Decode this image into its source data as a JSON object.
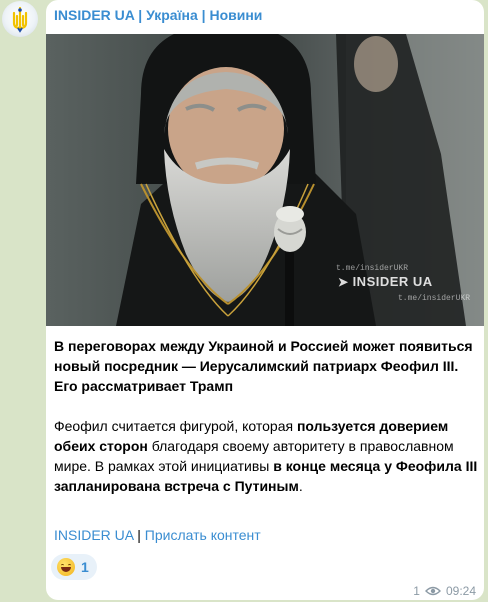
{
  "channel": {
    "name": "INSIDER UA | Україна | Новини",
    "avatar_icon": "trident-icon"
  },
  "photo": {
    "watermark_top": "t.me/insiderUKR",
    "watermark_brand": "INSIDER UA",
    "watermark_bottom": "t.me/insiderUKR",
    "plane_icon": "telegram-plane-icon"
  },
  "message": {
    "headline": "В переговорах между Украиной и Россией может появиться новый посредник — Иерусалимский патриарх Феофил III. Его рассматривает Трамп",
    "p2_a": "Феофил считается фигурой, которая ",
    "p2_b": "пользуется доверием обеих сторон",
    "p2_c": " благодаря своему авторитету в православном мире. В рамках этой инициативы ",
    "p2_d": "в конце месяца у Феофила III запланирована встреча с Путиным",
    "p2_e": "."
  },
  "footer_links": {
    "link1": "INSIDER UA",
    "separator": " | ",
    "link2": "Прислать контент"
  },
  "reaction": {
    "emoji_icon": "grinning-face-icon",
    "count": "1"
  },
  "meta": {
    "views": "1",
    "time": "09:24"
  },
  "colors": {
    "background": "#d9e4c8",
    "accent": "#3a8dd1",
    "meta_gray": "#8c9aa5"
  }
}
